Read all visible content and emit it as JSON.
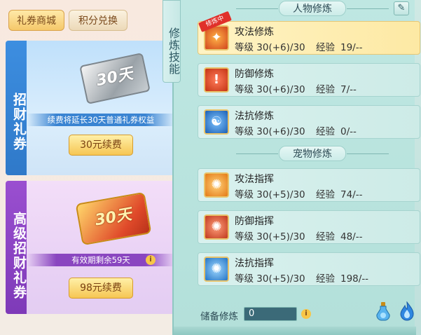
{
  "shop": {
    "tabs": [
      "礼券商城",
      "积分兑换"
    ],
    "normal": {
      "banner": "招财礼券",
      "ticket_text": "30天",
      "note": "续费将延长30天普通礼券权益",
      "button": "30元续费"
    },
    "premium": {
      "banner": "高级招财礼券",
      "ticket_text": "30天",
      "note": "有效期剩余59天",
      "button": "98元续费"
    }
  },
  "cultivation": {
    "side_tab": "修炼技能",
    "character_header": "人物修炼",
    "pet_header": "宠物修炼",
    "level_label": "等级",
    "exp_label": "经验",
    "active_tag": "修炼中",
    "character_skills": [
      {
        "name": "攻法修炼",
        "level": "30(+6)/30",
        "exp": "19/--",
        "icon": "fire-attack-icon",
        "active": true
      },
      {
        "name": "防御修炼",
        "level": "30(+6)/30",
        "exp": "7/--",
        "icon": "shield-defense-icon",
        "active": false
      },
      {
        "name": "法抗修炼",
        "level": "30(+6)/30",
        "exp": "0/--",
        "icon": "yin-yang-resist-icon",
        "active": false
      }
    ],
    "pet_skills": [
      {
        "name": "攻法指挥",
        "level": "30(+5)/30",
        "exp": "74/--",
        "icon": "paw-attack-icon",
        "active": false
      },
      {
        "name": "防御指挥",
        "level": "30(+5)/30",
        "exp": "48/--",
        "icon": "paw-defense-icon",
        "active": false
      },
      {
        "name": "法抗指挥",
        "level": "30(+5)/30",
        "exp": "198/--",
        "icon": "paw-resist-icon",
        "active": false
      }
    ],
    "reserve_label": "储备修炼",
    "reserve_value": "0"
  },
  "colors": {
    "panel_bg": "#b3e0da",
    "active_row": "#fde9a4",
    "normal_banner": "#2f79c9",
    "premium_banner": "#7e3ab8",
    "gold_button": "#f6c653"
  }
}
